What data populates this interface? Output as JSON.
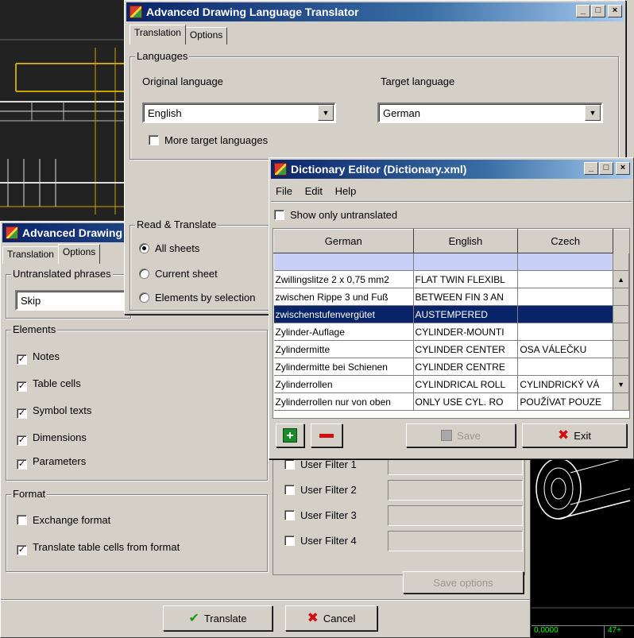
{
  "main_window": {
    "title": "Advanced Drawing Language Translator",
    "tabs": [
      "Translation",
      "Options"
    ],
    "languages": {
      "group_title": "Languages",
      "original_label": "Original language",
      "original_value": "English",
      "target_label": "Target language",
      "target_value": "German",
      "more_targets_label": "More target languages",
      "more_targets_checked": false
    },
    "read_translate": {
      "group_title": "Read & Translate",
      "options": [
        "All sheets",
        "Current sheet",
        "Elements by selection"
      ],
      "selected": 0
    }
  },
  "options_window": {
    "title": "Advanced Drawing Language Translator",
    "tabs": [
      "Translation",
      "Options"
    ],
    "untranslated": {
      "group_title": "Untranslated phrases",
      "value": "Skip"
    },
    "elements": {
      "group_title": "Elements",
      "items": [
        {
          "label": "Notes",
          "checked": true
        },
        {
          "label": "Table cells",
          "checked": true
        },
        {
          "label": "Symbol texts",
          "checked": true
        },
        {
          "label": "Dimensions",
          "checked": true
        },
        {
          "label": "Parameters",
          "checked": true
        }
      ]
    },
    "format": {
      "group_title": "Format",
      "items": [
        {
          "label": "Exchange format",
          "checked": false
        },
        {
          "label": "Translate table cells from format",
          "checked": true
        }
      ]
    },
    "user_filters": [
      "User Filter 1",
      "User Filter 2",
      "User Filter 3",
      "User Filter 4"
    ],
    "save_options_label": "Save options",
    "translate_label": "Translate",
    "cancel_label": "Cancel"
  },
  "dictionary_window": {
    "title": "Dictionary Editor (Dictionary.xml)",
    "menu": [
      "File",
      "Edit",
      "Help"
    ],
    "show_untranslated_label": "Show only untranslated",
    "columns": [
      "German",
      "English",
      "Czech"
    ],
    "rows": [
      [
        "",
        "",
        ""
      ],
      [
        "Zwillingslitze 2 x 0,75 mm2",
        "FLAT TWIN FLEXIBL",
        ""
      ],
      [
        "zwischen Rippe 3 und Fuß",
        "BETWEEN FIN 3 AN",
        ""
      ],
      [
        "zwischenstufenvergütet",
        "AUSTEMPERED",
        ""
      ],
      [
        "Zylinder-Auflage",
        "CYLINDER-MOUNTI",
        ""
      ],
      [
        "Zylindermitte",
        "CYLINDER CENTER",
        "OSA VÁLEČKU"
      ],
      [
        "Zylindermitte bei Schienen",
        "CYLINDER CENTRE",
        ""
      ],
      [
        "Zylinderrollen",
        "CYLINDRICAL ROLL",
        "CYLINDRICKÝ VÁ"
      ],
      [
        "Zylinderrollen nur von oben",
        "ONLY USE CYL. RO",
        "POUŽÍVAT POUZE"
      ]
    ],
    "selected_row": 3,
    "save_label": "Save",
    "exit_label": "Exit"
  },
  "cad_status": [
    "0,0000",
    "47+"
  ]
}
